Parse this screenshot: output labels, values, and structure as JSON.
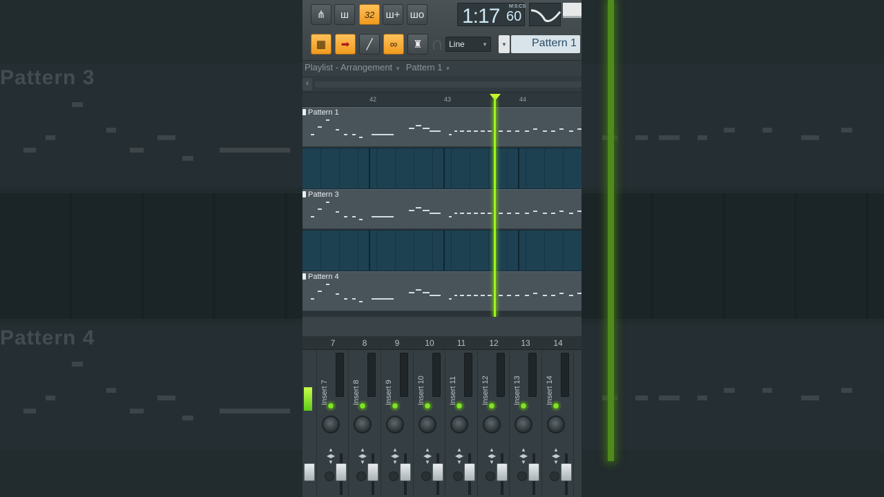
{
  "toolbar": {
    "buttons": [
      {
        "icon": "tempo-tap-icon",
        "glyph": "⋔"
      },
      {
        "icon": "metronome-icon",
        "glyph": "ш"
      },
      {
        "icon": "step-count-icon",
        "glyph": "32"
      },
      {
        "icon": "add-beat-icon",
        "glyph": "ш+"
      },
      {
        "icon": "loop-record-icon",
        "glyph": "шо"
      }
    ],
    "time": {
      "main": "1:17",
      "sub": "60",
      "unit": "M:S:CS"
    },
    "row2_buttons": [
      {
        "icon": "piano-roll-icon",
        "glyph": "▦"
      },
      {
        "icon": "arrow-right-icon",
        "glyph": "➡"
      },
      {
        "icon": "brush-icon",
        "glyph": "╱"
      },
      {
        "icon": "link-icon",
        "glyph": "∞"
      },
      {
        "icon": "stamp-icon",
        "glyph": "♜"
      }
    ],
    "magnet_icon": "magnet-icon",
    "snap_mode": "Line",
    "pattern_selector": "Pattern 1"
  },
  "breadcrumb": {
    "items": [
      "Playlist - Arrangement",
      "Pattern 1"
    ]
  },
  "ruler": {
    "bars": [
      "42",
      "43",
      "44"
    ]
  },
  "tracks": [
    {
      "label": "Pattern 1"
    },
    {
      "label": "Pattern 3"
    },
    {
      "label": "Pattern 4"
    }
  ],
  "mixer": {
    "channel_numbers": [
      "7",
      "8",
      "9",
      "10",
      "11",
      "12",
      "13",
      "14"
    ],
    "channels": [
      {
        "label": "Insert 7"
      },
      {
        "label": "Insert 8"
      },
      {
        "label": "Insert 9"
      },
      {
        "label": "Insert 10"
      },
      {
        "label": "Insert 11"
      },
      {
        "label": "Insert 12"
      },
      {
        "label": "Insert 13"
      },
      {
        "label": "Insert 14"
      }
    ]
  },
  "background": {
    "left_titles": [
      "Pattern 3",
      "Pattern 4"
    ]
  },
  "colors": {
    "playhead": "#9ef51a",
    "accent_orange": "#f5a623",
    "pattern_text": "#2a4c66"
  }
}
